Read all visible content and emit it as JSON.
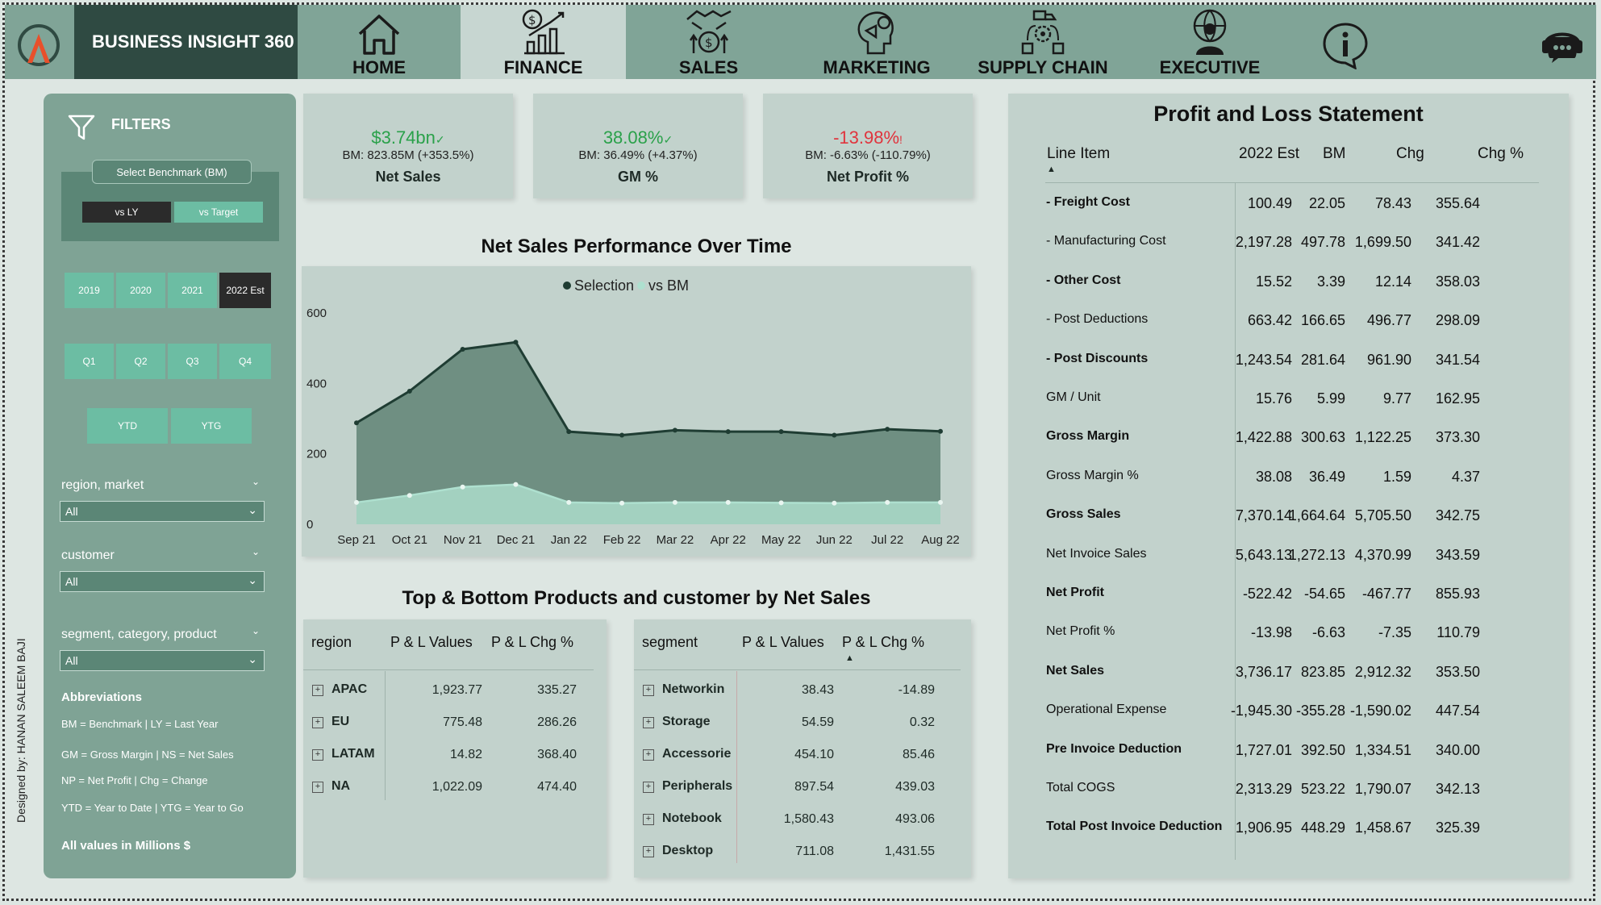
{
  "app": {
    "brand": "BUSINESS INSIGHT 360"
  },
  "nav": [
    {
      "label": "HOME",
      "icon": "home-icon",
      "active": false
    },
    {
      "label": "FINANCE",
      "icon": "finance-icon",
      "active": true
    },
    {
      "label": "SALES",
      "icon": "sales-icon",
      "active": false
    },
    {
      "label": "MARKETING",
      "icon": "marketing-icon",
      "active": false
    },
    {
      "label": "SUPPLY CHAIN",
      "icon": "supply-chain-icon",
      "active": false
    },
    {
      "label": "EXECUTIVE",
      "icon": "executive-icon",
      "active": false
    }
  ],
  "filters": {
    "title": "FILTERS",
    "benchmark_label": "Select Benchmark (BM)",
    "vs_ly": "vs LY",
    "vs_target": "vs Target",
    "years": [
      "2019",
      "2020",
      "2021",
      "2022 Est"
    ],
    "selected_year": "2022 Est",
    "quarters": [
      "Q1",
      "Q2",
      "Q3",
      "Q4"
    ],
    "ytd": "YTD",
    "ytg": "YTG",
    "region_label": "region, market",
    "region_value": "All",
    "customer_label": "customer",
    "customer_value": "All",
    "segment_label": "segment, category, product",
    "segment_value": "All",
    "abbr_title": "Abbreviations",
    "abbr": [
      "BM = Benchmark | LY = Last Year",
      "GM = Gross Margin | NS = Net Sales",
      "NP = Net Profit | Chg = Change",
      "YTD = Year to Date | YTG = Year to Go"
    ],
    "note": "All values in Millions $",
    "designer": "Designed by: HANAN SALEEM BAJI"
  },
  "kpis": [
    {
      "value": "$3.74bn",
      "mark": "✓",
      "bm": "BM: 823.85M (+353.5%)",
      "name": "Net Sales",
      "status": "pos"
    },
    {
      "value": "38.08%",
      "mark": "✓",
      "bm": "BM: 36.49% (+4.37%)",
      "name": "GM %",
      "status": "pos"
    },
    {
      "value": "-13.98%",
      "mark": "!",
      "bm": "BM: -6.63% (-110.79%)",
      "name": "Net Profit %",
      "status": "neg"
    }
  ],
  "chart_data": {
    "type": "area",
    "title": "Net Sales Performance Over Time",
    "categories": [
      "Sep 21",
      "Oct 21",
      "Nov 21",
      "Dec 21",
      "Jan 22",
      "Feb 22",
      "Mar 22",
      "Apr 22",
      "May 22",
      "Jun 22",
      "Jul 22",
      "Aug 22"
    ],
    "series": [
      {
        "name": "Selection",
        "color": "#1f3d33",
        "values": [
          288,
          378,
          497,
          517,
          263,
          253,
          267,
          263,
          263,
          253,
          270,
          264
        ]
      },
      {
        "name": "vs BM",
        "color": "#aee0cf",
        "values": [
          62,
          82,
          106,
          113,
          62,
          60,
          62,
          62,
          61,
          60,
          62,
          62
        ]
      }
    ],
    "yticks": [
      0,
      200,
      400,
      600
    ],
    "ylim": [
      0,
      600
    ],
    "legend": "top-center"
  },
  "products_title": "Top & Bottom Products and customer by Net Sales",
  "region_table": {
    "headers": [
      "region",
      "P & L Values",
      "P & L Chg %"
    ],
    "rows": [
      [
        "APAC",
        "1,923.77",
        "335.27"
      ],
      [
        "EU",
        "775.48",
        "286.26"
      ],
      [
        "LATAM",
        "14.82",
        "368.40"
      ],
      [
        "NA",
        "1,022.09",
        "474.40"
      ]
    ]
  },
  "segment_table": {
    "headers": [
      "segment",
      "P & L Values",
      "P & L Chg %"
    ],
    "rows": [
      [
        "Networkin",
        "38.43",
        "-14.89"
      ],
      [
        "Storage",
        "54.59",
        "0.32"
      ],
      [
        "Accessorie",
        "454.10",
        "85.46"
      ],
      [
        "Peripherals",
        "897.54",
        "439.03"
      ],
      [
        "Notebook",
        "1,580.43",
        "493.06"
      ],
      [
        "Desktop",
        "711.08",
        "1,431.55"
      ]
    ]
  },
  "pnl": {
    "title": "Profit and Loss Statement",
    "headers": [
      "Line Item",
      "2022 Est",
      "BM",
      "Chg",
      "Chg %"
    ],
    "rows": [
      {
        "item": "- Freight Cost",
        "bold": true,
        "v": [
          "100.49",
          "22.05",
          "78.43",
          "355.64"
        ]
      },
      {
        "item": "- Manufacturing Cost",
        "bold": false,
        "v": [
          "2,197.28",
          "497.78",
          "1,699.50",
          "341.42"
        ]
      },
      {
        "item": "- Other Cost",
        "bold": true,
        "v": [
          "15.52",
          "3.39",
          "12.14",
          "358.03"
        ]
      },
      {
        "item": "- Post Deductions",
        "bold": false,
        "v": [
          "663.42",
          "166.65",
          "496.77",
          "298.09"
        ]
      },
      {
        "item": "- Post Discounts",
        "bold": true,
        "v": [
          "1,243.54",
          "281.64",
          "961.90",
          "341.54"
        ]
      },
      {
        "item": "GM / Unit",
        "bold": false,
        "v": [
          "15.76",
          "5.99",
          "9.77",
          "162.95"
        ]
      },
      {
        "item": "Gross Margin",
        "bold": true,
        "v": [
          "1,422.88",
          "300.63",
          "1,122.25",
          "373.30"
        ]
      },
      {
        "item": "Gross Margin %",
        "bold": false,
        "v": [
          "38.08",
          "36.49",
          "1.59",
          "4.37"
        ]
      },
      {
        "item": "Gross Sales",
        "bold": true,
        "v": [
          "7,370.14",
          "1,664.64",
          "5,705.50",
          "342.75"
        ]
      },
      {
        "item": "Net Invoice Sales",
        "bold": false,
        "v": [
          "5,643.13",
          "1,272.13",
          "4,370.99",
          "343.59"
        ]
      },
      {
        "item": "Net Profit",
        "bold": true,
        "v": [
          "-522.42",
          "-54.65",
          "-467.77",
          "855.93"
        ]
      },
      {
        "item": "Net Profit %",
        "bold": false,
        "v": [
          "-13.98",
          "-6.63",
          "-7.35",
          "110.79"
        ]
      },
      {
        "item": "Net Sales",
        "bold": true,
        "v": [
          "3,736.17",
          "823.85",
          "2,912.32",
          "353.50"
        ]
      },
      {
        "item": "Operational Expense",
        "bold": false,
        "v": [
          "-1,945.30",
          "-355.28",
          "-1,590.02",
          "447.54"
        ]
      },
      {
        "item": "Pre Invoice Deduction",
        "bold": true,
        "v": [
          "1,727.01",
          "392.50",
          "1,334.51",
          "340.00"
        ]
      },
      {
        "item": "Total COGS",
        "bold": false,
        "v": [
          "2,313.29",
          "523.22",
          "1,790.07",
          "342.13"
        ]
      },
      {
        "item": "Total Post Invoice Deduction",
        "bold": true,
        "v": [
          "1,906.95",
          "448.29",
          "1,458.67",
          "325.39"
        ]
      }
    ]
  }
}
